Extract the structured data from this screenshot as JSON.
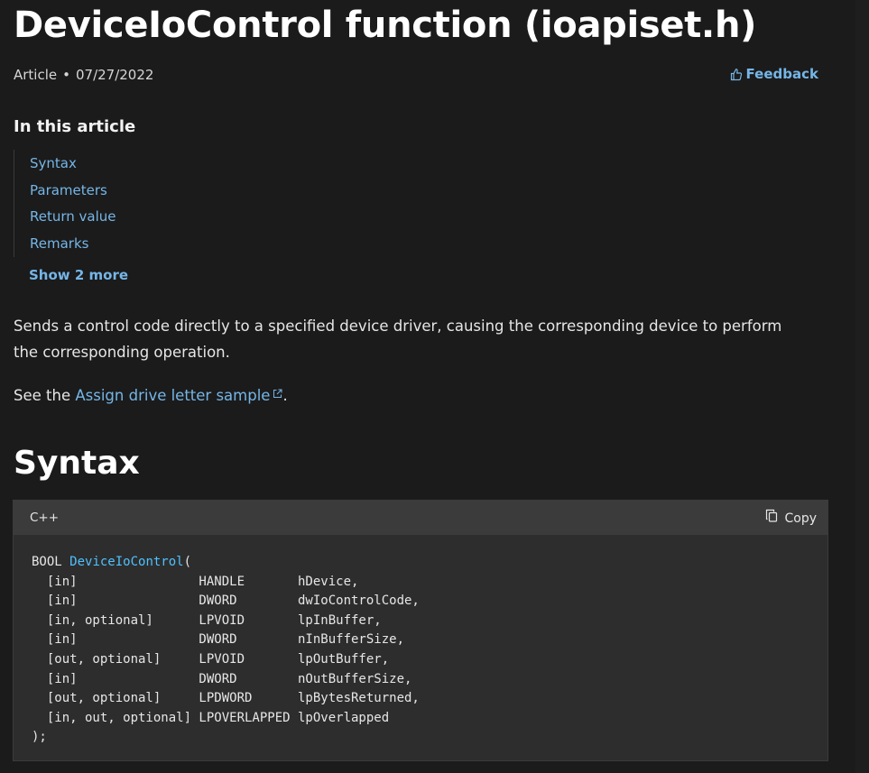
{
  "article": {
    "title": "DeviceIoControl function (ioapiset.h)",
    "type": "Article",
    "separator": "•",
    "date": "07/27/2022",
    "feedback_label": "Feedback"
  },
  "toc": {
    "heading": "In this article",
    "items": [
      {
        "label": "Syntax"
      },
      {
        "label": "Parameters"
      },
      {
        "label": "Return value"
      },
      {
        "label": "Remarks"
      }
    ],
    "show_more_label": "Show 2 more"
  },
  "content": {
    "description": "Sends a control code directly to a specified device driver, causing the corresponding device to perform the corresponding operation.",
    "see_prefix": "See the ",
    "see_link": "Assign drive letter sample",
    "see_suffix": "."
  },
  "syntax": {
    "heading": "Syntax",
    "language": "C++",
    "copy_label": "Copy",
    "code_open_prefix": "BOOL ",
    "code_function_name": "DeviceIoControl",
    "code_open_suffix": "(",
    "code_lines": [
      "  [in]                HANDLE       hDevice,",
      "  [in]                DWORD        dwIoControlCode,",
      "  [in, optional]      LPVOID       lpInBuffer,",
      "  [in]                DWORD        nInBufferSize,",
      "  [out, optional]     LPVOID       lpOutBuffer,",
      "  [in]                DWORD        nOutBufferSize,",
      "  [out, optional]     LPDWORD      lpBytesReturned,",
      "  [in, out, optional] LPOVERLAPPED lpOverlapped"
    ],
    "code_close": ");"
  },
  "icons": {
    "feedback": "thumbs-up-icon",
    "external_link": "external-link-icon",
    "copy": "copy-icon"
  },
  "colors": {
    "background": "#1b1b1b",
    "link": "#75b6e7",
    "code_background": "#2d2d2d",
    "code_header": "#3b3b3b",
    "function_name": "#4fc1ff"
  }
}
